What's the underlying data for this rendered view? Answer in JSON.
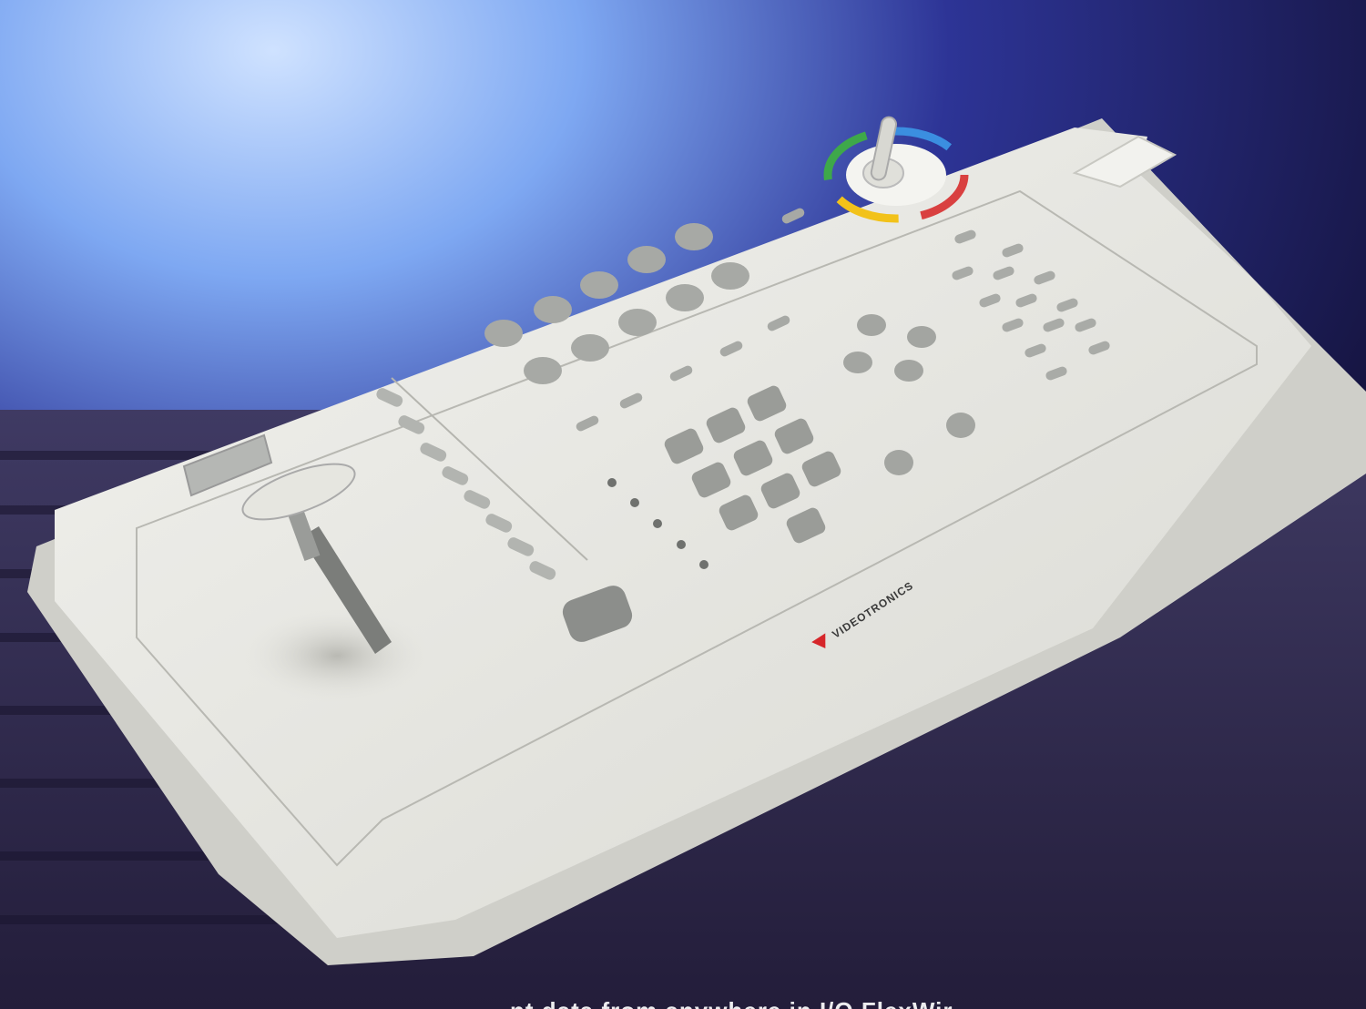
{
  "scene": {
    "subject": "video control keyboard with joysticks",
    "colors": {
      "background_sky_light": "#8fb8ff",
      "background_sky_dark": "#1d1e78",
      "background_floor": "#3c3457",
      "console_body": "#e9e9e4",
      "console_shadow": "#c9c9c3",
      "key_gray": "#a9aba7",
      "key_dark": "#8a8c89",
      "brand_red": "#d6262a"
    },
    "icons": [
      "joystick-icon",
      "color-ring-icon",
      "triangle-logo-icon"
    ]
  },
  "brand": {
    "label": "VIDEOTRONICS",
    "logo": "triangle-logo-icon"
  },
  "caption": {
    "text": "nt data from anywhere in I/O FlexWir"
  }
}
